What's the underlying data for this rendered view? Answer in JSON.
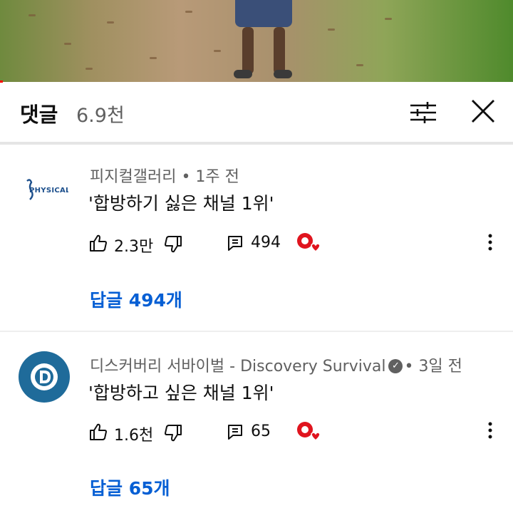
{
  "header": {
    "title": "댓글",
    "count": "6.9천"
  },
  "comments": [
    {
      "author": "피지컬갤러리",
      "time": "• 1주 전",
      "text": "'합방하기 싫은 채널 1위'",
      "likes": "2.3만",
      "replies_count": "494",
      "reply_link": "답글 494개",
      "avatar_text": "PHYSICAL",
      "verified": false,
      "creator_heart": true
    },
    {
      "author": "디스커버리 서바이벌 - Discovery Survival",
      "time": "• 3일 전",
      "text": "'합방하고 싶은 채널 1위'",
      "likes": "1.6천",
      "replies_count": "65",
      "reply_link": "답글 65개",
      "avatar_text": "",
      "verified": true,
      "creator_heart": true
    }
  ],
  "icons": {
    "filter": "filter-sliders-icon",
    "close": "close-icon",
    "like": "thumbs-up-icon",
    "dislike": "thumbs-down-icon",
    "reply": "reply-comment-icon",
    "heart": "creator-heart-icon",
    "more": "more-vertical-icon",
    "verified": "verified-check-icon"
  },
  "colors": {
    "link": "#065fd4",
    "meta": "#606060",
    "progress": "#ff0000",
    "heart": "#e0141e",
    "discovery": "#1f6b9a"
  }
}
